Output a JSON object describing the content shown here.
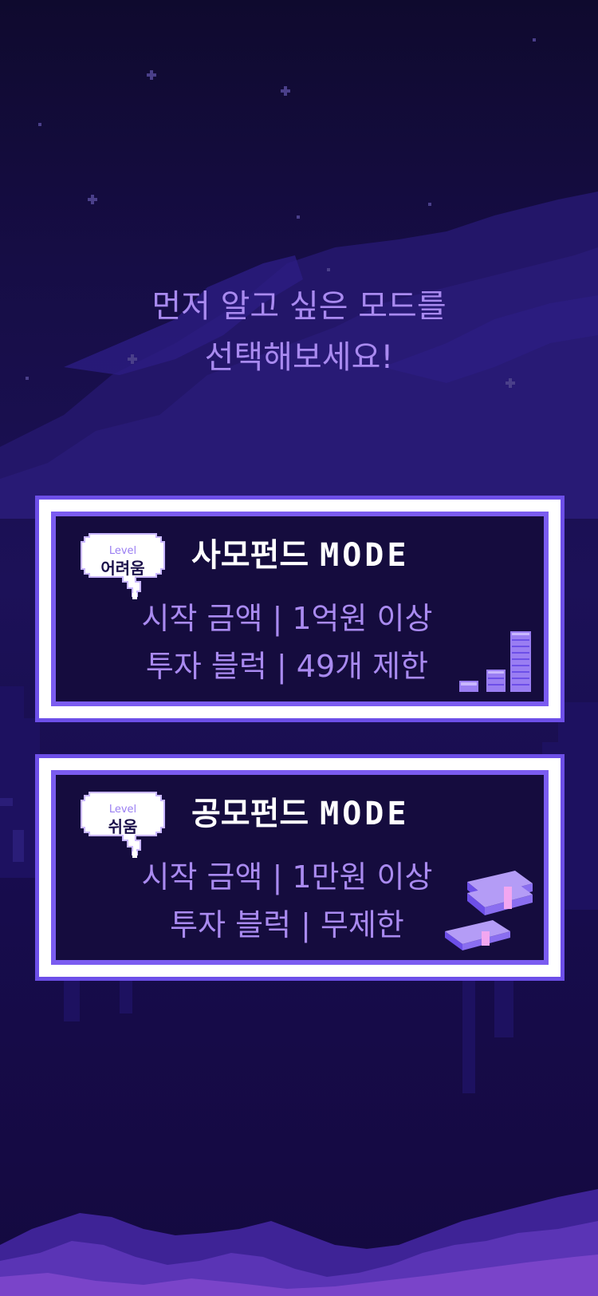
{
  "headline": {
    "line1": "먼저 알고 싶은 모드를",
    "line2": "선택해보세요!"
  },
  "modes": [
    {
      "level_label": "Level",
      "difficulty": "어려움",
      "title": "사모펀드",
      "mode_word": "MODE",
      "start_amount": "시작 금액 | 1억원 이상",
      "invest_blocks": "투자 블럭 | 49개 제한",
      "icon": "coin-stack-icon"
    },
    {
      "level_label": "Level",
      "difficulty": "쉬움",
      "title": "공모펀드",
      "mode_word": "MODE",
      "start_amount": "시작 금액 | 1만원 이상",
      "invest_blocks": "투자 블럭 | 무제한",
      "icon": "cash-bundle-icon"
    }
  ],
  "colors": {
    "accent": "#7b5cf0",
    "text_lavender": "#a98af0",
    "card_bg": "#150c3e",
    "background": "#1c1158"
  }
}
